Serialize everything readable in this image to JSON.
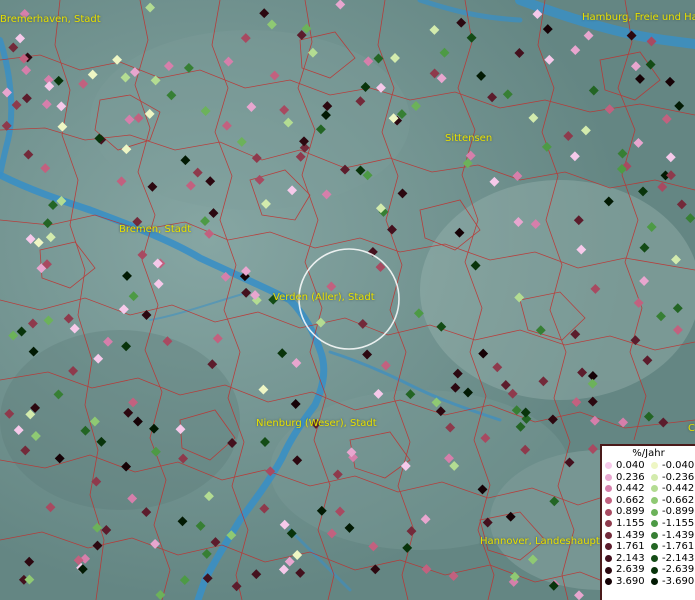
{
  "places": [
    {
      "id": "bremerhaven",
      "label": "Bremerhaven, Stadt"
    },
    {
      "id": "hamburg",
      "label": "Hamburg, Freie und Ha"
    },
    {
      "id": "sittensen",
      "label": "Sittensen"
    },
    {
      "id": "bremen",
      "label": "Bremen, Stadt"
    },
    {
      "id": "verden",
      "label": "Verden (Aller), Stadt"
    },
    {
      "id": "nienburg",
      "label": "Nienburg (Weser), Stadt"
    },
    {
      "id": "hannover",
      "label": "Hannover, Landeshaupt"
    },
    {
      "id": "edge-c",
      "label": "C"
    }
  ],
  "legend": {
    "title": "%/Jahr",
    "positive": [
      {
        "label": "0.040",
        "color": "#f6c9ea"
      },
      {
        "label": "0.236",
        "color": "#e8a6cf"
      },
      {
        "label": "0.442",
        "color": "#d67fab"
      },
      {
        "label": "0.662",
        "color": "#c2617f"
      },
      {
        "label": "0.899",
        "color": "#a84a61"
      },
      {
        "label": "1.155",
        "color": "#8e3a4c"
      },
      {
        "label": "1.439",
        "color": "#732a3a"
      },
      {
        "label": "1.761",
        "color": "#5c1c2c"
      },
      {
        "label": "2.143",
        "color": "#44111e"
      },
      {
        "label": "2.639",
        "color": "#2c0810"
      },
      {
        "label": "3.690",
        "color": "#160206"
      }
    ],
    "negative": [
      {
        "label": "-0.040",
        "color": "#eef6c4"
      },
      {
        "label": "-0.236",
        "color": "#d3ebad"
      },
      {
        "label": "-0.442",
        "color": "#b3dc92"
      },
      {
        "label": "-0.662",
        "color": "#8fc973"
      },
      {
        "label": "-0.899",
        "color": "#6cb25a"
      },
      {
        "label": "-1.155",
        "color": "#4d9a45"
      },
      {
        "label": "-1.439",
        "color": "#377f34"
      },
      {
        "label": "-1.761",
        "color": "#236524"
      },
      {
        "label": "-2.143",
        "color": "#144c16"
      },
      {
        "label": "-2.639",
        "color": "#09340b"
      },
      {
        "label": "-3.690",
        "color": "#021a03"
      }
    ]
  },
  "colors": {
    "background": "#6f8f8c",
    "river": "#3a8fc4",
    "boundary": "#c0302e",
    "label": "#e8e000",
    "selection_ring": "#ffffff"
  }
}
